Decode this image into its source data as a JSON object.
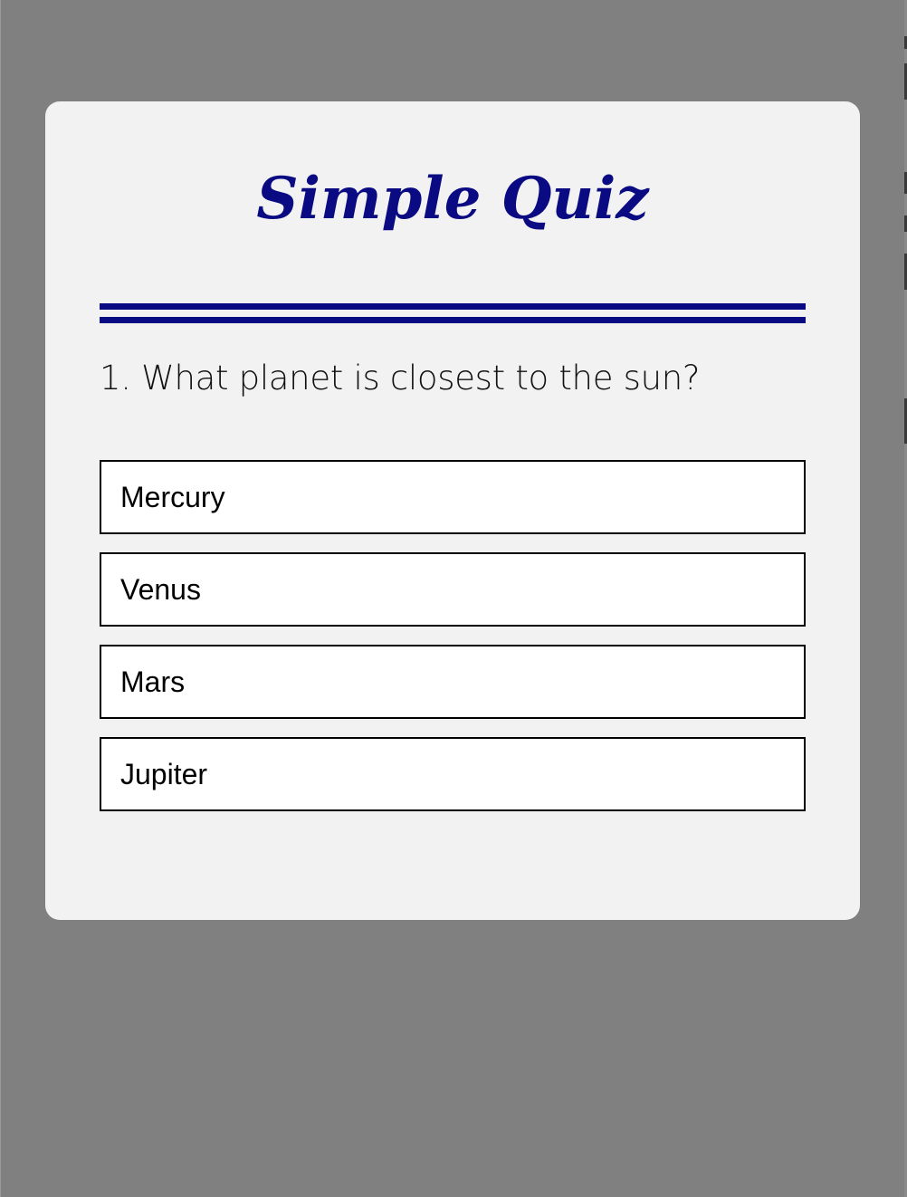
{
  "quiz": {
    "title": "Simple Quiz",
    "question": "1. What planet is closest to the sun?",
    "answers": [
      {
        "label": "Mercury"
      },
      {
        "label": "Venus"
      },
      {
        "label": "Mars"
      },
      {
        "label": "Jupiter"
      }
    ]
  },
  "colors": {
    "background": "#808080",
    "card": "#f2f2f2",
    "accent": "#0a0a82",
    "answer_bg": "#ffffff",
    "answer_border": "#000000"
  }
}
